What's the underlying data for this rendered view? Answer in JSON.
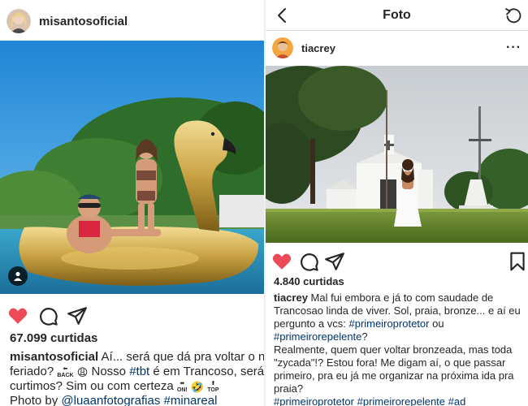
{
  "left_post": {
    "username": "misantosoficial",
    "likes": "67.099 curtidas",
    "caption": {
      "line1_user": "misantosoficial",
      "line1_text": " Aí... será que dá pra voltar o nosso",
      "line2_a": "feriado? ",
      "back_sign": "BACK",
      "line2_b": " Nosso ",
      "tag_tbt": "#tbt",
      "line2_c": " é em Trancoso, será",
      "line3_a": "curtimos? Sim ou com certeza ",
      "on_sign": "ON!",
      "top_sign": "TOP",
      "line4_a": "Photo by ",
      "tag_photographer": "@luaanfotografias",
      "tag_mina": "#minareal"
    }
  },
  "right_post": {
    "nav_title": "Foto",
    "username": "tiacrey",
    "likes": "4.840 curtidas",
    "caption": {
      "user": "tiacrey",
      "text1": " Mal fui embora e já to com saudade de Trancosao linda de viver. Sol, praia, bronze... e aí eu pergunto a vcs: ",
      "tag1": "#primeiroprotetor",
      "text2": " ou",
      "tag2": "#primeirorepelente",
      "text3": "?",
      "para2": "Realmente, quem quer voltar bronzeada, mas toda \"zycada\"!? Estou fora! Me digam aí, o que passar primeiro, pra eu já me organizar na próxima ida pra praia?",
      "tag3": "#primeiroprotetor",
      "tag4": "#primeirorepelente",
      "tag5": "#ad"
    }
  },
  "colors": {
    "liked_heart": "#ed4956",
    "hashtag": "#003569",
    "text": "#262626"
  }
}
